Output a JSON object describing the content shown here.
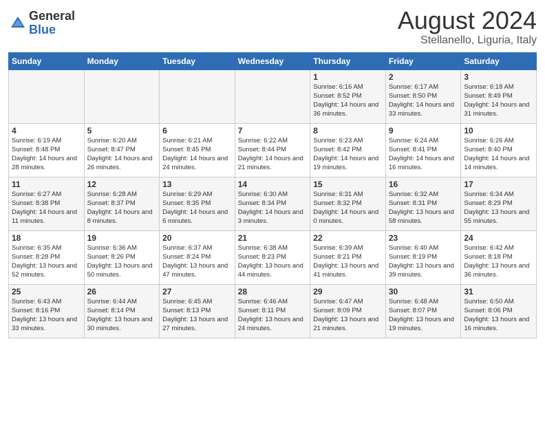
{
  "logo": {
    "general": "General",
    "blue": "Blue"
  },
  "title": "August 2024",
  "location": "Stellanello, Liguria, Italy",
  "days_of_week": [
    "Sunday",
    "Monday",
    "Tuesday",
    "Wednesday",
    "Thursday",
    "Friday",
    "Saturday"
  ],
  "weeks": [
    [
      {
        "day": "",
        "info": ""
      },
      {
        "day": "",
        "info": ""
      },
      {
        "day": "",
        "info": ""
      },
      {
        "day": "",
        "info": ""
      },
      {
        "day": "1",
        "info": "Sunrise: 6:16 AM\nSunset: 8:52 PM\nDaylight: 14 hours and 36 minutes."
      },
      {
        "day": "2",
        "info": "Sunrise: 6:17 AM\nSunset: 8:50 PM\nDaylight: 14 hours and 33 minutes."
      },
      {
        "day": "3",
        "info": "Sunrise: 6:18 AM\nSunset: 8:49 PM\nDaylight: 14 hours and 31 minutes."
      }
    ],
    [
      {
        "day": "4",
        "info": "Sunrise: 6:19 AM\nSunset: 8:48 PM\nDaylight: 14 hours and 28 minutes."
      },
      {
        "day": "5",
        "info": "Sunrise: 6:20 AM\nSunset: 8:47 PM\nDaylight: 14 hours and 26 minutes."
      },
      {
        "day": "6",
        "info": "Sunrise: 6:21 AM\nSunset: 8:45 PM\nDaylight: 14 hours and 24 minutes."
      },
      {
        "day": "7",
        "info": "Sunrise: 6:22 AM\nSunset: 8:44 PM\nDaylight: 14 hours and 21 minutes."
      },
      {
        "day": "8",
        "info": "Sunrise: 6:23 AM\nSunset: 8:42 PM\nDaylight: 14 hours and 19 minutes."
      },
      {
        "day": "9",
        "info": "Sunrise: 6:24 AM\nSunset: 8:41 PM\nDaylight: 14 hours and 16 minutes."
      },
      {
        "day": "10",
        "info": "Sunrise: 6:26 AM\nSunset: 8:40 PM\nDaylight: 14 hours and 14 minutes."
      }
    ],
    [
      {
        "day": "11",
        "info": "Sunrise: 6:27 AM\nSunset: 8:38 PM\nDaylight: 14 hours and 11 minutes."
      },
      {
        "day": "12",
        "info": "Sunrise: 6:28 AM\nSunset: 8:37 PM\nDaylight: 14 hours and 8 minutes."
      },
      {
        "day": "13",
        "info": "Sunrise: 6:29 AM\nSunset: 8:35 PM\nDaylight: 14 hours and 6 minutes."
      },
      {
        "day": "14",
        "info": "Sunrise: 6:30 AM\nSunset: 8:34 PM\nDaylight: 14 hours and 3 minutes."
      },
      {
        "day": "15",
        "info": "Sunrise: 6:31 AM\nSunset: 8:32 PM\nDaylight: 14 hours and 0 minutes."
      },
      {
        "day": "16",
        "info": "Sunrise: 6:32 AM\nSunset: 8:31 PM\nDaylight: 13 hours and 58 minutes."
      },
      {
        "day": "17",
        "info": "Sunrise: 6:34 AM\nSunset: 8:29 PM\nDaylight: 13 hours and 55 minutes."
      }
    ],
    [
      {
        "day": "18",
        "info": "Sunrise: 6:35 AM\nSunset: 8:28 PM\nDaylight: 13 hours and 52 minutes."
      },
      {
        "day": "19",
        "info": "Sunrise: 6:36 AM\nSunset: 8:26 PM\nDaylight: 13 hours and 50 minutes."
      },
      {
        "day": "20",
        "info": "Sunrise: 6:37 AM\nSunset: 8:24 PM\nDaylight: 13 hours and 47 minutes."
      },
      {
        "day": "21",
        "info": "Sunrise: 6:38 AM\nSunset: 8:23 PM\nDaylight: 13 hours and 44 minutes."
      },
      {
        "day": "22",
        "info": "Sunrise: 6:39 AM\nSunset: 8:21 PM\nDaylight: 13 hours and 41 minutes."
      },
      {
        "day": "23",
        "info": "Sunrise: 6:40 AM\nSunset: 8:19 PM\nDaylight: 13 hours and 39 minutes."
      },
      {
        "day": "24",
        "info": "Sunrise: 6:42 AM\nSunset: 8:18 PM\nDaylight: 13 hours and 36 minutes."
      }
    ],
    [
      {
        "day": "25",
        "info": "Sunrise: 6:43 AM\nSunset: 8:16 PM\nDaylight: 13 hours and 33 minutes."
      },
      {
        "day": "26",
        "info": "Sunrise: 6:44 AM\nSunset: 8:14 PM\nDaylight: 13 hours and 30 minutes."
      },
      {
        "day": "27",
        "info": "Sunrise: 6:45 AM\nSunset: 8:13 PM\nDaylight: 13 hours and 27 minutes."
      },
      {
        "day": "28",
        "info": "Sunrise: 6:46 AM\nSunset: 8:11 PM\nDaylight: 13 hours and 24 minutes."
      },
      {
        "day": "29",
        "info": "Sunrise: 6:47 AM\nSunset: 8:09 PM\nDaylight: 13 hours and 21 minutes."
      },
      {
        "day": "30",
        "info": "Sunrise: 6:48 AM\nSunset: 8:07 PM\nDaylight: 13 hours and 19 minutes."
      },
      {
        "day": "31",
        "info": "Sunrise: 6:50 AM\nSunset: 8:06 PM\nDaylight: 13 hours and 16 minutes."
      }
    ]
  ]
}
